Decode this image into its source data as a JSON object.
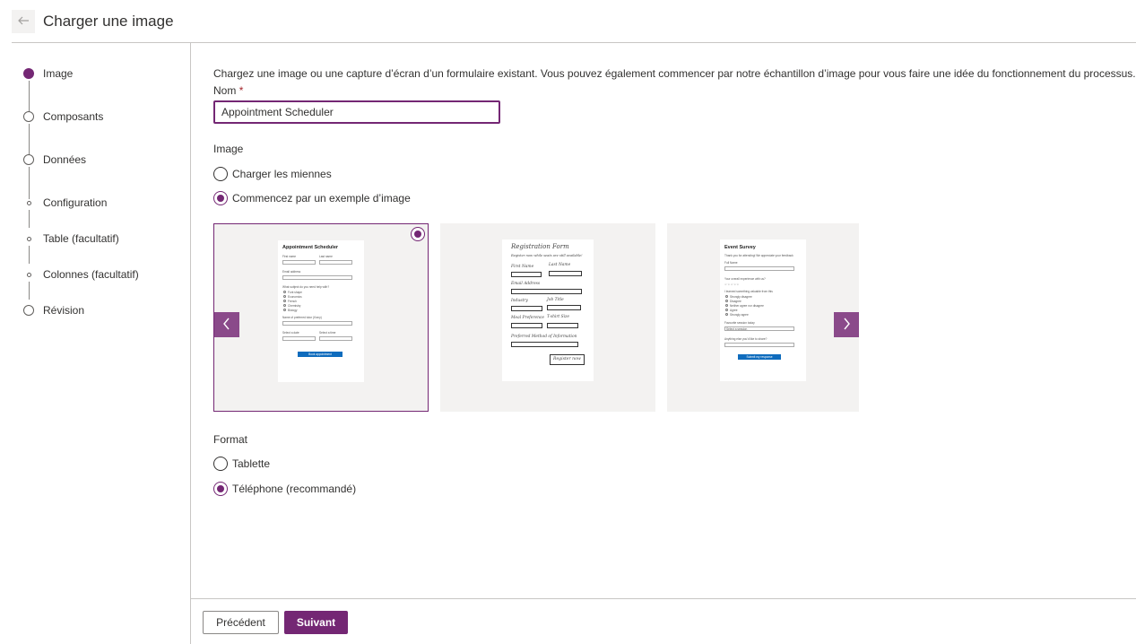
{
  "header": {
    "title": "Charger une image",
    "back_icon": "arrow-left-icon"
  },
  "steps": [
    {
      "label": "Image",
      "state": "current"
    },
    {
      "label": "Composants",
      "state": "pending"
    },
    {
      "label": "Données",
      "state": "pending"
    },
    {
      "label": "Configuration",
      "state": "pending-optional-style"
    },
    {
      "label": "Table (facultatif)",
      "state": "pending-optional-style"
    },
    {
      "label": "Colonnes (facultatif)",
      "state": "pending-optional-style"
    },
    {
      "label": "Révision",
      "state": "pending"
    }
  ],
  "main": {
    "intro": "Chargez une image ou une capture d’écran d’un formulaire existant. Vous pouvez également commencer par notre échantillon d’image pour vous faire une idée du fonctionnement du processus.",
    "name_label": "Nom",
    "name_required_mark": "*",
    "name_value": "Appointment Scheduler",
    "image_section_label": "Image",
    "image_options": [
      {
        "label": "Charger les miennes",
        "checked": false
      },
      {
        "label": "Commencez par un exemple d’image",
        "checked": true
      }
    ],
    "samples": [
      {
        "name": "Appointment Scheduler",
        "selected": true,
        "fields": [
          "First name",
          "Last name",
          "Enter your first name",
          "Enter your last name",
          "Email address",
          "Enter your email address",
          "What subject do you need help with?",
          "Font shape",
          "Economics",
          "French",
          "Chemistry",
          "Biology",
          "Name of preferred tutor (if any)",
          "No preference",
          "Select a date",
          "Select a time",
          "Book appointment"
        ]
      },
      {
        "name": "Registration Form",
        "selected": false,
        "fields": [
          "Register now while seats are still available!",
          "First Name",
          "Last Name",
          "Email Address",
          "Industry",
          "Job Title",
          "Meal Preference",
          "T-shirt Size",
          "Preferred Method of Information",
          "Register now"
        ]
      },
      {
        "name": "Event Survey",
        "selected": false,
        "fields": [
          "Thank you for attending! We appreciate your feedback",
          "Full Name",
          "Your overall experience with us?",
          "I learned something valuable from this",
          "Strongly disagree",
          "Disagree",
          "Neither agree nor disagree",
          "Agree",
          "Strongly agree",
          "Favourite session today",
          "Select a session",
          "Anything else you'd like to share?",
          "Submit my response"
        ]
      }
    ],
    "carousel_prev_icon": "chevron-left-icon",
    "carousel_next_icon": "chevron-right-icon",
    "format_section_label": "Format",
    "format_options": [
      {
        "label": "Tablette",
        "checked": false
      },
      {
        "label": "Téléphone (recommandé)",
        "checked": true
      }
    ]
  },
  "footer": {
    "prev_label": "Précédent",
    "next_label": "Suivant"
  },
  "colors": {
    "accent": "#742774",
    "arrow_bg": "#8a4a8a",
    "card_bg": "#f3f2f1"
  }
}
